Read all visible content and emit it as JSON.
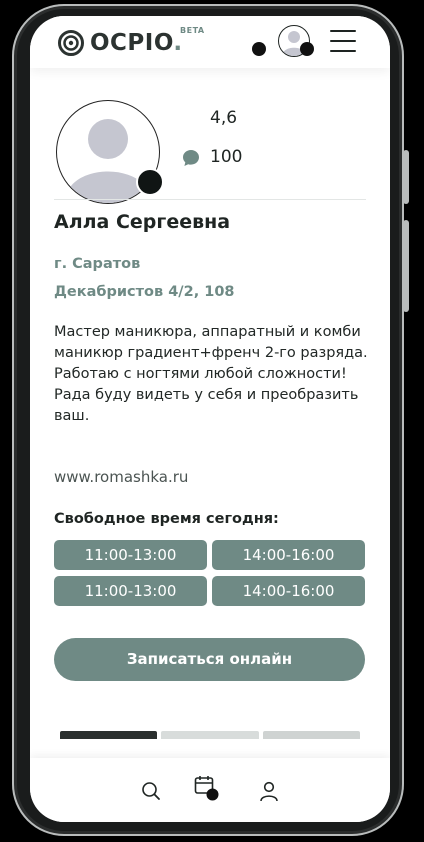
{
  "header": {
    "logo_text": "OCPIO",
    "logo_dot": ".",
    "beta": "BETA"
  },
  "profile": {
    "rating": "4,6",
    "reviews": "100",
    "name": "Алла Сергеевна",
    "city": "г. Саратов",
    "address": "Декабристов 4/2, 108",
    "description": "Мастер маникюра, аппаратный и комби маникюр градиент+френч 2-го разряда.\nРаботаю с ногтями любой сложности! Рада буду видеть у себя и преобразить ваш.",
    "website": "www.romashka.ru"
  },
  "schedule": {
    "title": "Свободное время сегодня:",
    "slots": [
      "11:00-13:00",
      "14:00-16:00",
      "11:00-13:00",
      "14:00-16:00"
    ]
  },
  "actions": {
    "book_label": "Записаться онлайн"
  },
  "colors": {
    "accent": "#6f8a85",
    "text": "#1f2523"
  },
  "nav": {
    "icons": [
      "search-icon",
      "calendar-icon",
      "profile-icon"
    ]
  }
}
